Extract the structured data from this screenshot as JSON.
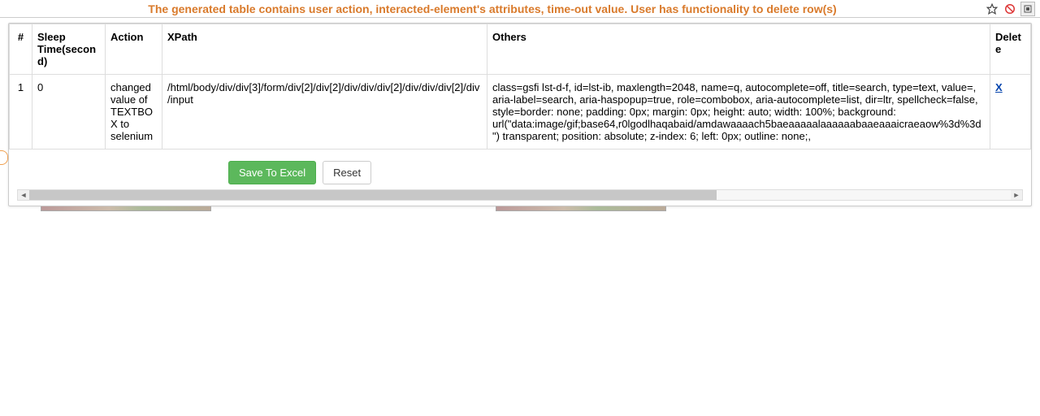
{
  "topbar": {
    "title": "The generated table contains user action, interacted-element's attributes, time-out value. User has functionality to delete row(s)"
  },
  "table": {
    "headers": {
      "num": "#",
      "sleep": "Sleep Time(second)",
      "action": "Action",
      "xpath": "XPath",
      "others": "Others",
      "delete": "Delete"
    },
    "rows": [
      {
        "num": "1",
        "sleep": "0",
        "action": "changed value of TEXTBOX to selenium",
        "xpath": "/html/body/div/div[3]/form/div[2]/div[2]/div/div/div[2]/div/div/div[2]/div/input",
        "others": "class=gsfi lst-d-f, id=lst-ib, maxlength=2048, name=q, autocomplete=off, title=search, type=text, value=, aria-label=search, aria-haspopup=true, role=combobox, aria-autocomplete=list, dir=ltr, spellcheck=false, style=border: none; padding: 0px; margin: 0px; height: auto; width: 100%; background: url(\"data:image/gif;base64,r0lgodlhaqabaid/amdawaaaach5baeaaaaalaaaaaabaaeaaaicraeaow%3d%3d\") transparent; position: absolute; z-index: 6; left: 0px; outline: none;,",
        "delete": "X"
      }
    ]
  },
  "buttons": {
    "save": "Save To Excel",
    "reset": "Reset"
  }
}
